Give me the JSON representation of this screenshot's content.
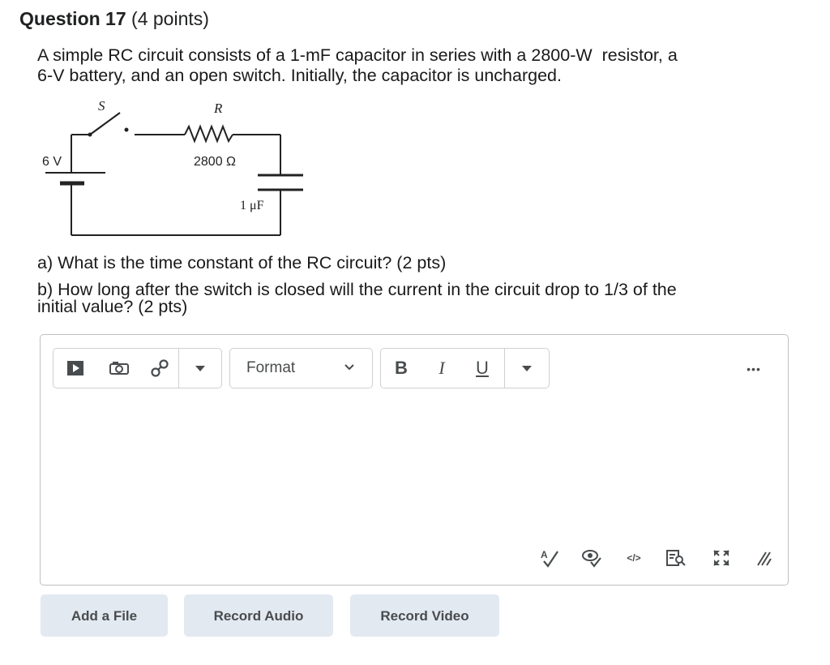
{
  "question": {
    "title": "Question 17",
    "points": "(4 points)",
    "text_line1": "A simple RC circuit consists of a 1-mF capacitor in series with a 2800-W  resistor, a",
    "text_line2": "6-V battery, and an open switch.  Initially, the capacitor is uncharged.",
    "part_a": "a) What is the time constant of the RC circuit? (2 pts)",
    "part_b_line1": "b) How long after the switch is closed will the current in the circuit drop to 1/3 of the",
    "part_b_line2": "initial value? (2 pts)"
  },
  "circuit": {
    "switch_label": "S",
    "resistor_label": "R",
    "battery_label": "6 V",
    "resistance_value": "2800 Ω",
    "capacitance_value": "1 μF"
  },
  "editor": {
    "toolbar": {
      "format_label": "Format",
      "bold": "B",
      "italic": "I",
      "underline": "U",
      "more": "•••"
    }
  },
  "actions": {
    "add_file": "Add a File",
    "record_audio": "Record Audio",
    "record_video": "Record Video"
  },
  "colors": {
    "button_bg": "#e3e9f1",
    "icon": "#494c4e",
    "border": "#bfbfbf"
  }
}
